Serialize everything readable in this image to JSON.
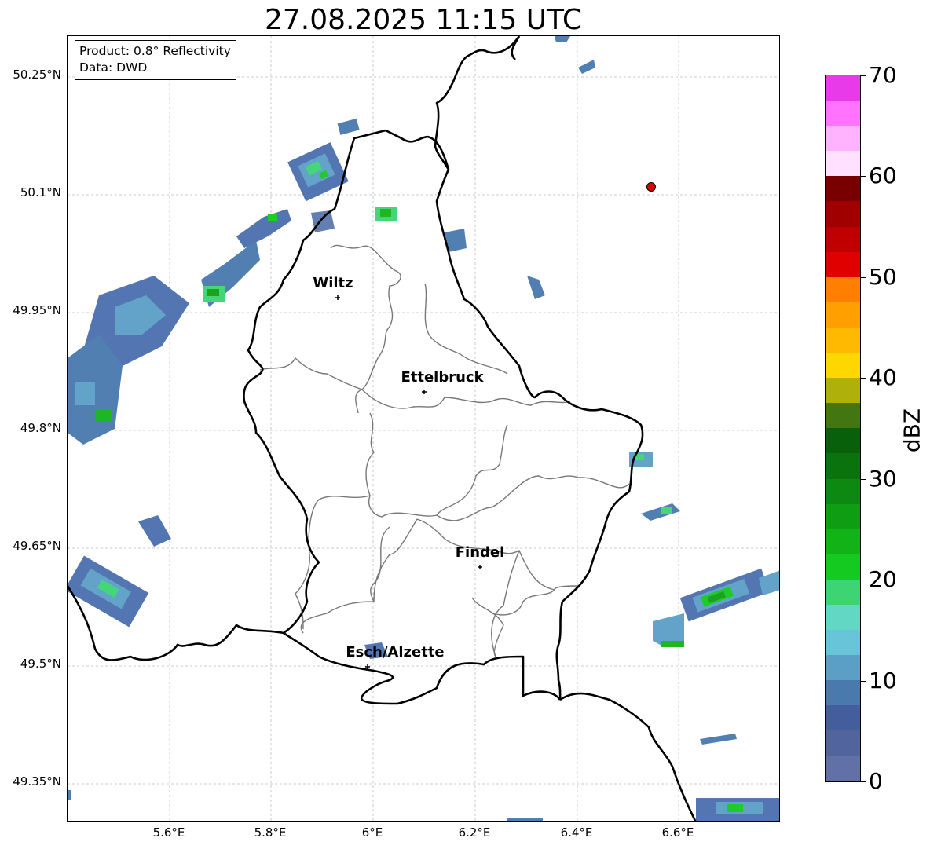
{
  "title": "27.08.2025 11:15 UTC",
  "info": {
    "product": "Product: 0.8° Reflectivity",
    "data": "Data: DWD"
  },
  "latitude_labels": [
    "50.25°N",
    "50.1°N",
    "49.95°N",
    "49.8°N",
    "49.65°N",
    "49.5°N",
    "49.35°N"
  ],
  "longitude_labels": [
    "5.6°E",
    "5.8°E",
    "6°E",
    "6.2°E",
    "6.4°E",
    "6.6°E"
  ],
  "cities": [
    {
      "name": "Wiltz"
    },
    {
      "name": "Ettelbruck"
    },
    {
      "name": "Findel"
    },
    {
      "name": "Esch/Alzette"
    }
  ],
  "colorbar": {
    "label": "dBZ",
    "ticks": [
      "0",
      "10",
      "20",
      "30",
      "40",
      "50",
      "60",
      "70"
    ],
    "min": 0,
    "max": 70,
    "step": 2.5,
    "colors": [
      "#6171a8",
      "#52649e",
      "#445d9c",
      "#4979ad",
      "#5b9fc7",
      "#67c4d9",
      "#62d7c3",
      "#3dd473",
      "#14c920",
      "#12b316",
      "#0f9e13",
      "#0d8810",
      "#0b730d",
      "#08600b",
      "#417610",
      "#b0b00a",
      "#ffd700",
      "#ffba00",
      "#ffa000",
      "#ff8000",
      "#e00000",
      "#c00000",
      "#a00000",
      "#780000",
      "#ffe0ff",
      "#ffb3ff",
      "#ff73ff",
      "#e83ae8"
    ]
  },
  "marker_color": "#dd0000"
}
